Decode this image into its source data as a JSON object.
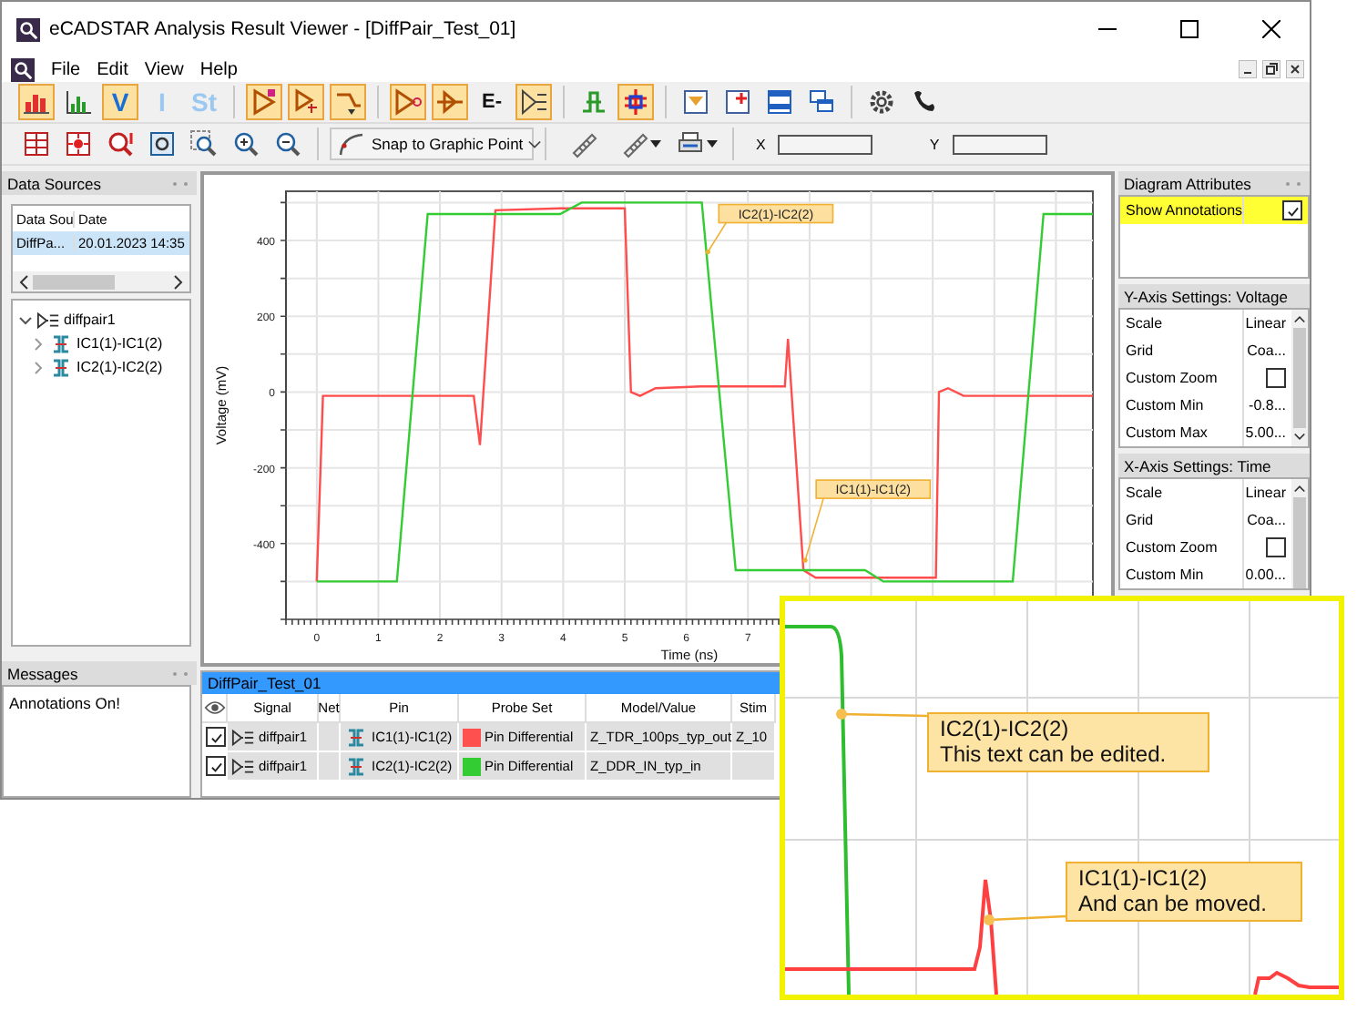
{
  "window": {
    "title": "eCADSTAR Analysis Result Viewer - [DiffPair_Test_01]"
  },
  "menu": [
    "File",
    "Edit",
    "View",
    "Help"
  ],
  "toolbar_main": [
    [
      {
        "kind": "bars",
        "selected": true
      },
      {
        "kind": "histogram",
        "selected": false
      },
      {
        "kind": "letter",
        "label": "V",
        "selected": true
      },
      {
        "kind": "letter",
        "label": "I",
        "selected": false
      },
      {
        "kind": "letter",
        "label": "St",
        "selected": false
      }
    ],
    [
      {
        "kind": "probe",
        "selected": true
      },
      {
        "kind": "step",
        "selected": true
      },
      {
        "kind": "dropdown",
        "selected": true
      }
    ],
    [
      {
        "kind": "driver",
        "selected": true
      },
      {
        "kind": "receiver",
        "selected": true
      },
      {
        "kind": "glyph",
        "label": "E-",
        "selected": false
      },
      {
        "kind": "branch",
        "selected": true
      }
    ],
    [
      {
        "kind": "circuit",
        "selected": false
      },
      {
        "kind": "circuit2",
        "selected": true
      }
    ],
    [
      {
        "kind": "panel",
        "selected": false
      },
      {
        "kind": "panel2",
        "selected": false
      },
      {
        "kind": "split",
        "selected": false
      },
      {
        "kind": "cascade",
        "selected": false
      }
    ],
    [
      {
        "kind": "gear",
        "selected": false
      },
      {
        "kind": "phone",
        "selected": false
      }
    ]
  ],
  "toolbar_view": {
    "zoom_tools": [
      {
        "kind": "table"
      },
      {
        "kind": "target"
      },
      {
        "kind": "alert"
      },
      {
        "kind": "fit"
      },
      {
        "kind": "zoombox"
      },
      {
        "kind": "zoomin"
      },
      {
        "kind": "zoomout"
      }
    ],
    "snap": {
      "label": "Snap to Graphic Point"
    },
    "measure_tools": [
      {
        "kind": "ruler",
        "menu": false
      },
      {
        "kind": "ruler",
        "menu": true
      },
      {
        "kind": "print",
        "menu": true
      }
    ],
    "x_field": {
      "label": "X"
    },
    "y_field": {
      "label": "Y"
    }
  },
  "data_sources": {
    "title": "Data Sources",
    "columns": [
      "Data Sou",
      "Date"
    ],
    "rows": [
      {
        "cells": [
          "DiffPa...",
          "20.01.2023 14:35"
        ],
        "selected": true
      }
    ],
    "tree": [
      {
        "label": "diffpair1",
        "expanded": true,
        "children": [
          {
            "label": "IC1(1)-IC1(2)",
            "expanded": false
          },
          {
            "label": "IC2(1)-IC2(2)",
            "expanded": false
          }
        ]
      }
    ]
  },
  "messages": {
    "title": "Messages",
    "lines": [
      "Annotations On!"
    ]
  },
  "chart": {
    "chart_data": {
      "type": "line",
      "xlabel": "Time (ns)",
      "ylabel": "Voltage (mV)",
      "x": [
        0,
        0.1,
        1.3,
        1.8,
        2.55,
        2.65,
        2.9,
        3.95,
        4.3,
        5.0,
        5.1,
        5.25,
        5.5,
        6.25,
        6.8,
        7.6,
        7.65,
        7.9,
        8.1,
        8.9,
        9.2,
        10.05,
        10.1,
        10.25,
        10.5,
        11.3,
        11.8,
        12.6
      ],
      "series": [
        {
          "color": "#ff4d4d",
          "values": [
            -500,
            -10,
            -10,
            -10,
            -10,
            -140,
            480,
            485,
            485,
            485,
            0,
            -10,
            10,
            15,
            15,
            15,
            140,
            -470,
            -490,
            -490,
            -490,
            -490,
            0,
            10,
            -10,
            -10,
            -10,
            -10
          ]
        },
        {
          "color": "#33cc33",
          "values": [
            -500,
            -500,
            -500,
            470,
            470,
            470,
            470,
            470,
            500,
            500,
            500,
            500,
            500,
            500,
            -470,
            -470,
            -470,
            -470,
            -470,
            -470,
            -500,
            -500,
            -500,
            -500,
            -500,
            -500,
            470,
            470
          ]
        }
      ],
      "xlim": [
        -0.5,
        12.6
      ],
      "ylim": [
        -600,
        530
      ],
      "grid": true,
      "xticks": [
        0,
        1,
        2,
        3,
        4,
        5,
        6,
        7
      ],
      "yticks": [
        -400,
        -200,
        0,
        200,
        400
      ],
      "annotations": [
        {
          "text": "IC2(1)-IC2(2)",
          "x": 6.35,
          "y": 370
        },
        {
          "text": "IC1(1)-IC1(2)",
          "x": 7.93,
          "y": -444
        }
      ]
    }
  },
  "signal_table": {
    "title": "DiffPair_Test_01",
    "columns": [
      "Signal",
      "Net",
      "Pin",
      "Probe Set",
      "Model/Value",
      "Stim"
    ],
    "rows": [
      {
        "checked": true,
        "signal": "diffpair1",
        "pin": "IC1(1)-IC1(2)",
        "color": "#ff5050",
        "probe_set": "Pin Differential",
        "model": "Z_TDR_100ps_typ_out",
        "stim": "Z_10"
      },
      {
        "checked": true,
        "signal": "diffpair1",
        "pin": "IC2(1)-IC2(2)",
        "color": "#33cc33",
        "probe_set": "Pin Differential",
        "model": "Z_DDR_IN_typ_in"
      }
    ]
  },
  "diagram_attributes": {
    "title": "Diagram Attributes",
    "rows": [
      {
        "label": "Show Annotations",
        "checked": true,
        "selected": true
      }
    ]
  },
  "axis_settings": [
    {
      "title": "Y-Axis Settings: Voltage",
      "rows": [
        {
          "kind": "text",
          "label": "Scale",
          "value": "Linear"
        },
        {
          "kind": "text",
          "label": "Grid",
          "value": "Coa..."
        },
        {
          "kind": "check",
          "label": "Custom Zoom",
          "checked": false
        },
        {
          "kind": "text",
          "label": "Custom Min",
          "value": "-0.8..."
        },
        {
          "kind": "text",
          "label": "Custom Max",
          "value": "5.00..."
        }
      ]
    },
    {
      "title": "X-Axis Settings: Time",
      "rows": [
        {
          "kind": "text",
          "label": "Scale",
          "value": "Linear"
        },
        {
          "kind": "text",
          "label": "Grid",
          "value": "Coa..."
        },
        {
          "kind": "check",
          "label": "Custom Zoom",
          "checked": false
        },
        {
          "kind": "text",
          "label": "Custom Min",
          "value": "0.00..."
        }
      ]
    }
  ],
  "magnified_view": {
    "notes": [
      {
        "title": "IC2(1)-IC2(2)",
        "text": "This text can be edited."
      },
      {
        "title": "IC1(1)-IC1(2)",
        "text": "And can be moved."
      }
    ]
  }
}
